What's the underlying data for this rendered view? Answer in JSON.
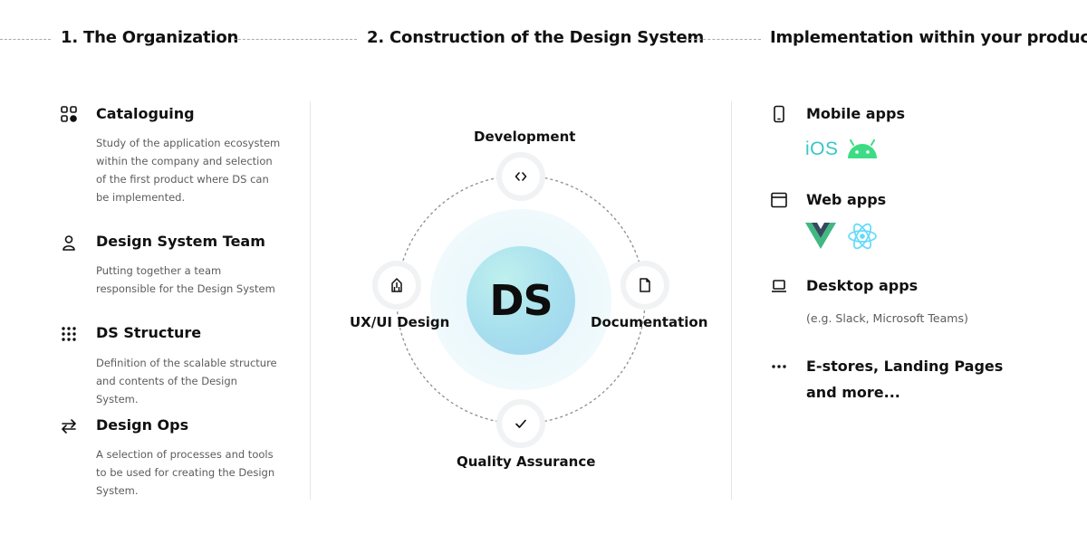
{
  "header": {
    "step1": "1. The Organization",
    "step2": "2. Construction of the Design System",
    "step3": "Implementation within your products"
  },
  "organization": {
    "items": [
      {
        "title": "Cataloguing",
        "icon": "grid-icon",
        "description": "Study of the application ecosystem within the company and selection of the first product where DS can be implemented."
      },
      {
        "title": "Design System Team",
        "icon": "person-icon",
        "description": "Putting together a team responsible for the Design System"
      },
      {
        "title": "DS Structure",
        "icon": "dots-grid-icon",
        "description": "Definition of the scalable structure and contents of the Design System."
      },
      {
        "title": "Design Ops",
        "icon": "swap-arrows-icon",
        "description": "A selection of processes and tools to be used for creating the Design System."
      }
    ]
  },
  "construction": {
    "center": "DS",
    "nodes": {
      "top": {
        "label": "Development",
        "icon": "code-icon"
      },
      "left": {
        "label": "UX/UI Design",
        "icon": "pen-nib-icon"
      },
      "right": {
        "label": "Documentation",
        "icon": "document-icon"
      },
      "bottom": {
        "label": "Quality Assurance",
        "icon": "checkmark-icon"
      }
    }
  },
  "products": {
    "items": [
      {
        "title": "Mobile apps",
        "icon": "phone-icon",
        "logos": [
          "ios-logo",
          "android-logo"
        ],
        "ios_text": "iOS"
      },
      {
        "title": "Web apps",
        "icon": "browser-window-icon",
        "logos": [
          "vue-logo",
          "react-logo"
        ]
      },
      {
        "title": "Desktop apps",
        "icon": "laptop-icon",
        "note": "(e.g. Slack, Microsoft Teams)"
      },
      {
        "title_line1": "E-stores, Landing Pages",
        "title_line2": "and more...",
        "icon": "ellipsis-icon"
      }
    ]
  },
  "colors": {
    "ios": "#36c7c9",
    "android": "#3ddc84",
    "vue_green": "#41b883",
    "vue_dark": "#35495e",
    "react": "#61dafb",
    "ds_core": "#a9e0ee",
    "text_muted": "#5c5c5c"
  }
}
